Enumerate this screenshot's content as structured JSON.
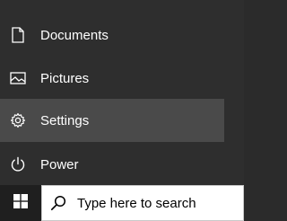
{
  "start_menu": {
    "items": [
      {
        "label": "Documents",
        "icon": "document-icon"
      },
      {
        "label": "Pictures",
        "icon": "pictures-icon"
      },
      {
        "label": "Settings",
        "icon": "gear-icon"
      },
      {
        "label": "Power",
        "icon": "power-icon"
      }
    ]
  },
  "taskbar": {
    "start_icon": "windows-logo-icon",
    "search": {
      "placeholder": "Type here to search",
      "icon": "search-icon"
    }
  },
  "colors": {
    "menu_bg": "#2e2e2e",
    "hover_bg": "#4a4a4a",
    "taskbar_bg": "#1f1f1f",
    "text": "#ffffff"
  }
}
